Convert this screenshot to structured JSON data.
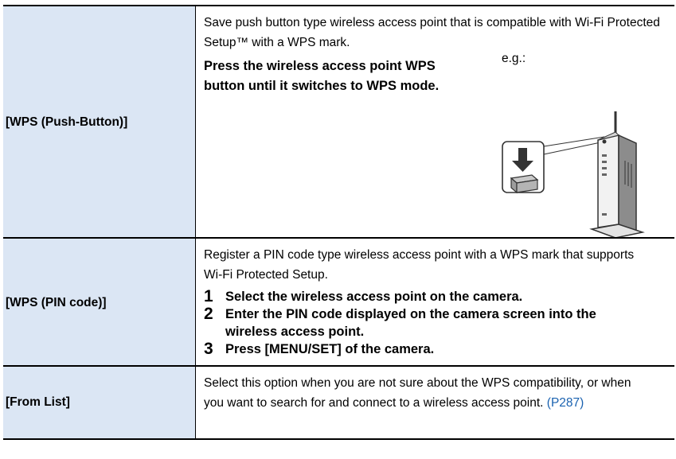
{
  "rows": [
    {
      "label": "[WPS (Push-Button)]",
      "desc": "Save push button type wireless access point that is compatible with Wi-Fi Protected Setup™ with a WPS mark.",
      "instruction": "Press the wireless access point WPS button until it switches to WPS mode.",
      "example_label": "e.g.:",
      "illustration_icon": "wireless-router-wps-button-icon"
    },
    {
      "label": "[WPS (PIN code)]",
      "desc": "Register a PIN code type wireless access point with a WPS mark that supports Wi-Fi Protected Setup.",
      "steps": [
        {
          "num": "1",
          "text": "Select the wireless access point on the camera."
        },
        {
          "num": "2",
          "text": "Enter the PIN code displayed on the camera screen into the wireless access point."
        },
        {
          "num": "3",
          "text": "Press [MENU/SET] of the camera."
        }
      ]
    },
    {
      "label": "[From List]",
      "desc": "Select this option when you are not sure about the WPS compatibility, or when you want to search for and connect to a wireless access point.",
      "link": "(P287)"
    }
  ],
  "colors": {
    "label_bg": "#dbe6f4",
    "link": "#1a62b0"
  }
}
